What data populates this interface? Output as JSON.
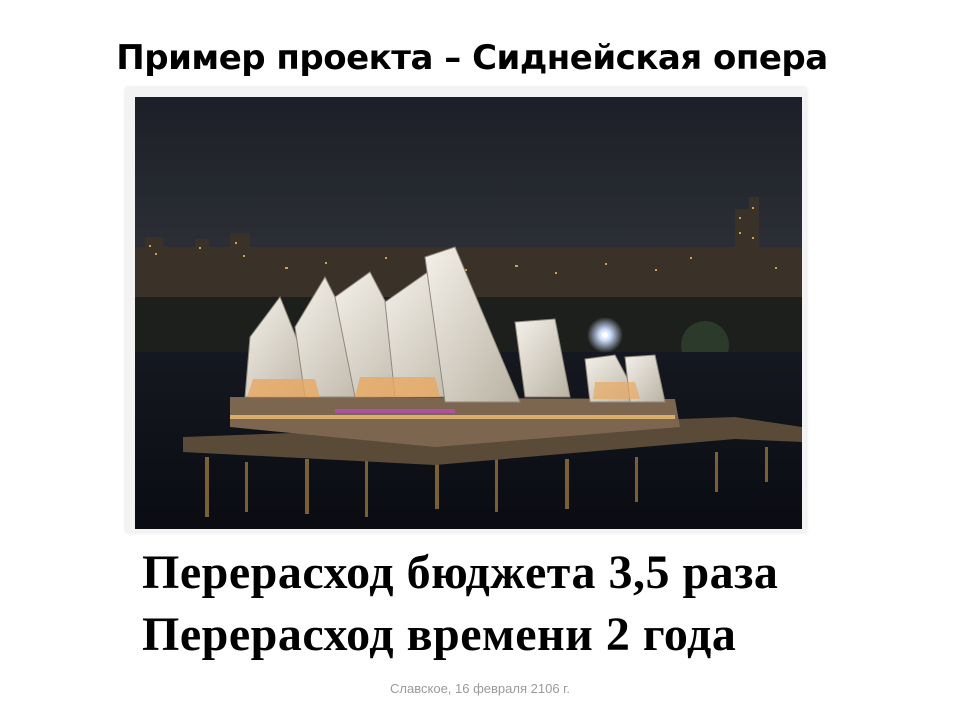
{
  "slide": {
    "title": "Пример проекта – Сиднейская опера",
    "photo": {
      "subject": "sydney-opera-house-night-photo"
    },
    "lines": [
      "Перерасход бюджета 3,5 раза",
      "Перерасход времени 2 года"
    ],
    "footer": "Славское, 16 февраля 2106 г."
  }
}
